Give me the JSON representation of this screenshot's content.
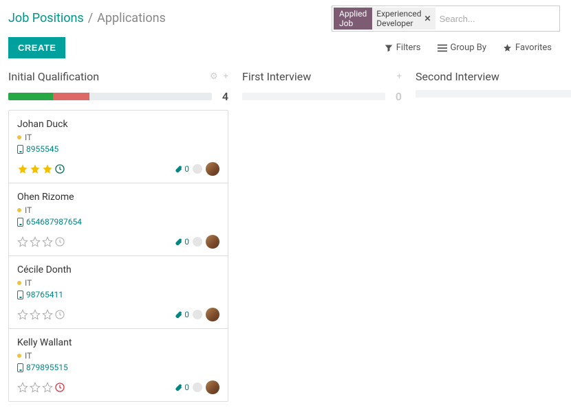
{
  "breadcrumb": {
    "parent": "Job Positions",
    "sep": "/",
    "current": "Applications"
  },
  "search": {
    "facet_label": "Applied Job",
    "facet_value": "Experienced Developer",
    "placeholder": "Search..."
  },
  "create_btn": "CREATE",
  "toolbar": {
    "filters": "Filters",
    "group_by": "Group By",
    "favorites": "Favorites"
  },
  "columns": [
    {
      "title": "Initial Qualification",
      "count": "4",
      "show_tools": true,
      "progress": {
        "green": 22,
        "red": 18
      },
      "cards": [
        {
          "name": "Johan Duck",
          "dept": "IT",
          "phone": "8955545",
          "stars": 3,
          "clock": "green",
          "attachments": "0"
        },
        {
          "name": "Ohen Rizome",
          "dept": "IT",
          "phone": "654687987654",
          "stars": 0,
          "clock": "grey",
          "attachments": "0"
        },
        {
          "name": "Cécile Donth",
          "dept": "IT",
          "phone": "98765411",
          "stars": 0,
          "clock": "grey",
          "attachments": "0"
        },
        {
          "name": "Kelly Wallant",
          "dept": "IT",
          "phone": "879895515",
          "stars": 0,
          "clock": "red",
          "attachments": "0"
        }
      ]
    },
    {
      "title": "First Interview",
      "count": "0",
      "show_tools": false,
      "progress": null,
      "cards": []
    },
    {
      "title": "Second Interview",
      "count": "",
      "show_tools": false,
      "progress": null,
      "cards": []
    }
  ]
}
